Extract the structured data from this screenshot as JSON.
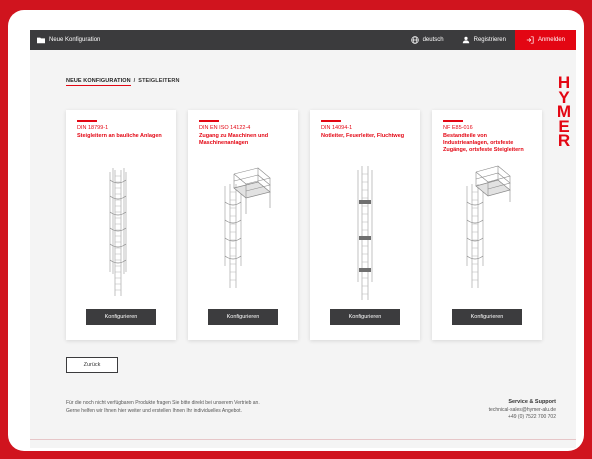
{
  "topbar": {
    "title": "Neue Konfiguration",
    "language": "deutsch",
    "register": "Registrieren",
    "login": "Anmelden"
  },
  "breadcrumb": {
    "first": "NEUE KONFIGURATION",
    "separator": "/",
    "current": "STEIGLEITERN"
  },
  "logo": {
    "letters": [
      "H",
      "Y",
      "M",
      "E",
      "R"
    ]
  },
  "cards": [
    {
      "norm": "DIN 18799-1",
      "title": "Steigleitern an bauliche Anlagen",
      "button": "Konfigurieren"
    },
    {
      "norm": "DIN EN ISO 14122-4",
      "title": "Zugang zu Maschinen und Maschinenanlagen",
      "button": "Konfigurieren"
    },
    {
      "norm": "DIN 14094-1",
      "title": "Notleiter, Feuerleiter, Fluchtweg",
      "button": "Konfigurieren"
    },
    {
      "norm": "NF E85-016",
      "title": "Bestandteile von Industrieanlagen, ortsfeste Zugänge, ortsfeste Steigleitern",
      "button": "Konfigurieren"
    }
  ],
  "back_button": "Zurück",
  "footer": {
    "note": "Für die noch nicht verfügbaren Produkte fragen Sie bitte direkt bei unserem Vertrieb an. Gerne helfen wir Ihnen hier weiter und erstellen Ihnen Ihr individuelles Angebot.",
    "service_heading": "Service & Support",
    "email": "technical-sales@hymer-alu.de",
    "phone": "+49 (0) 7522 700 702"
  },
  "colors": {
    "accent": "#e30613",
    "dark": "#3b3b3d",
    "background": "#d0141e"
  }
}
